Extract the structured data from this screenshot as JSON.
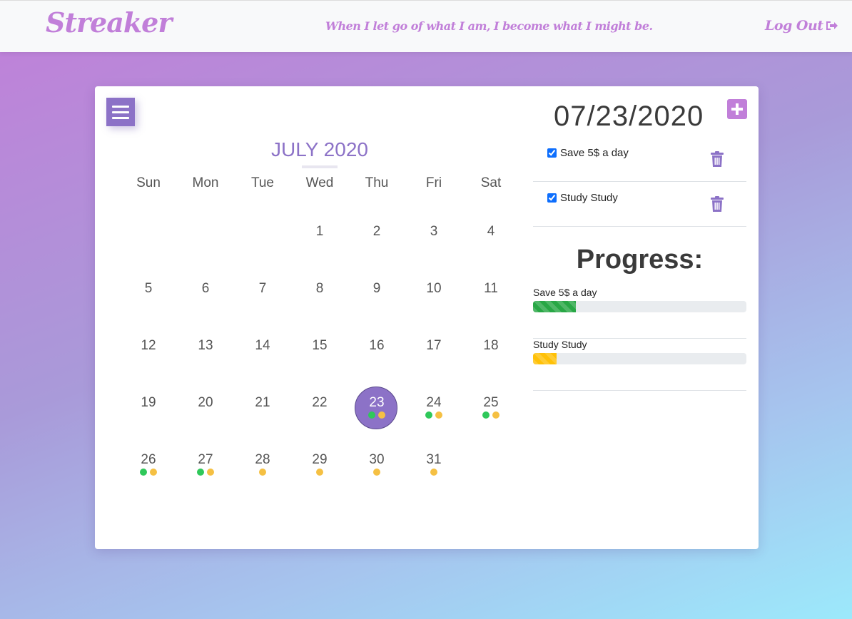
{
  "navbar": {
    "brand": "Streaker",
    "quote": "When I let go of what I am, I become what I might be.",
    "logout_label": "Log Out",
    "logout_icon": "sign-out-icon"
  },
  "calendar": {
    "month_title": "JULY 2020",
    "weekdays": [
      "Sun",
      "Mon",
      "Tue",
      "Wed",
      "Thu",
      "Fri",
      "Sat"
    ],
    "first_weekday_index": 3,
    "days_in_month": 31,
    "today": 23,
    "dots": {
      "23": [
        "green",
        "yellow"
      ],
      "24": [
        "green",
        "yellow"
      ],
      "25": [
        "green",
        "yellow"
      ],
      "26": [
        "green",
        "yellow"
      ],
      "27": [
        "green",
        "yellow"
      ],
      "28": [
        "yellow"
      ],
      "29": [
        "yellow"
      ],
      "30": [
        "yellow"
      ],
      "31": [
        "yellow"
      ]
    }
  },
  "panel": {
    "date": "07/23/2020",
    "tasks": [
      {
        "label": "Save 5$ a day",
        "checked": true
      },
      {
        "label": "Study Study",
        "checked": true
      }
    ],
    "progress_title": "Progress:",
    "progress": [
      {
        "label": "Save 5$ a day",
        "percent": 20,
        "color": "#28a745"
      },
      {
        "label": "Study Study",
        "percent": 11,
        "color": "#ffc107"
      }
    ]
  },
  "colors": {
    "accent": "#c17fd9",
    "primary_purple": "#8c72c7",
    "dot_green": "#2fc85a",
    "dot_yellow": "#f5c043"
  }
}
